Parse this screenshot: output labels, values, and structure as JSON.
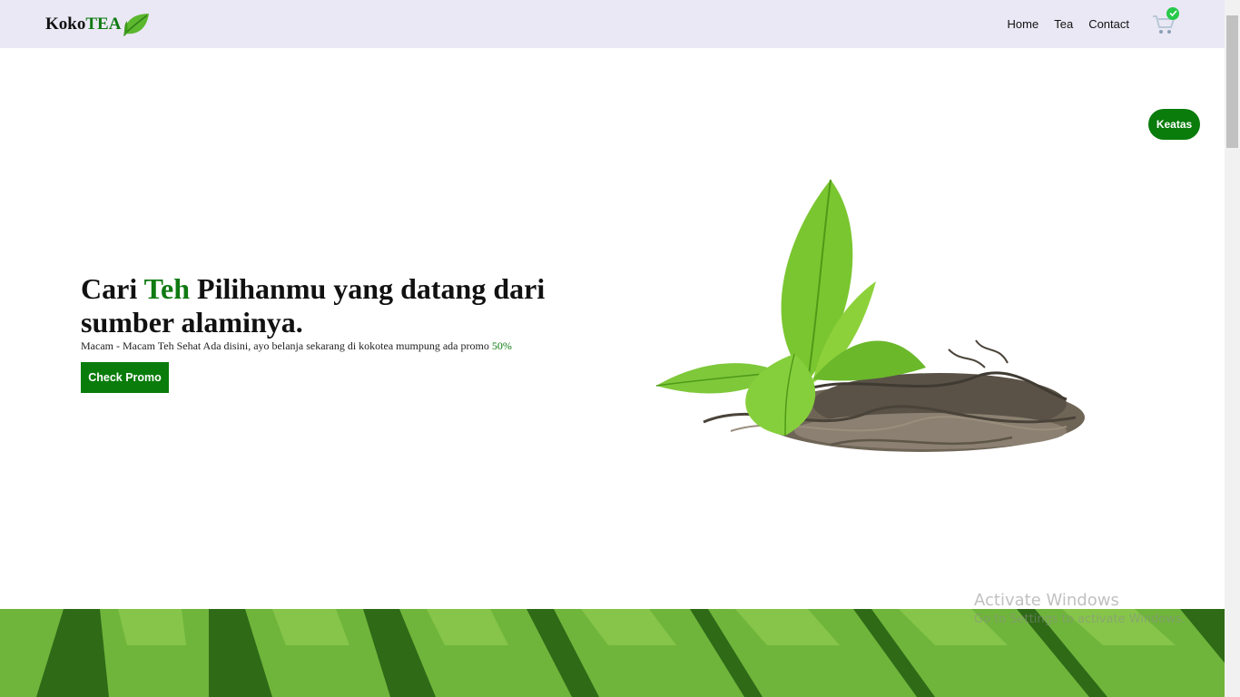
{
  "navbar": {
    "logo_prefix": "Koko",
    "logo_accent": "TEA",
    "links": [
      "Home",
      "Tea",
      "Contact"
    ],
    "cart_icon": "cart-icon",
    "cart_badge_icon": "check-icon"
  },
  "keatas_label": "Keatas",
  "hero": {
    "title_before": "Cari ",
    "title_highlight": "Teh",
    "title_after": " Pilihanmu yang datang dari sumber alaminya.",
    "subtitle_before": "Macam - Macam Teh Sehat Ada disini, ayo belanja sekarang di kokotea mumpung ada promo ",
    "subtitle_highlight": "50%",
    "button_label": "Check Promo"
  },
  "watermark": {
    "line1": "Activate Windows",
    "line2": "Go to Settings to activate Windows."
  },
  "colors": {
    "brand_green": "#0a7c0c",
    "navbar_bg": "#ebe8f5"
  }
}
